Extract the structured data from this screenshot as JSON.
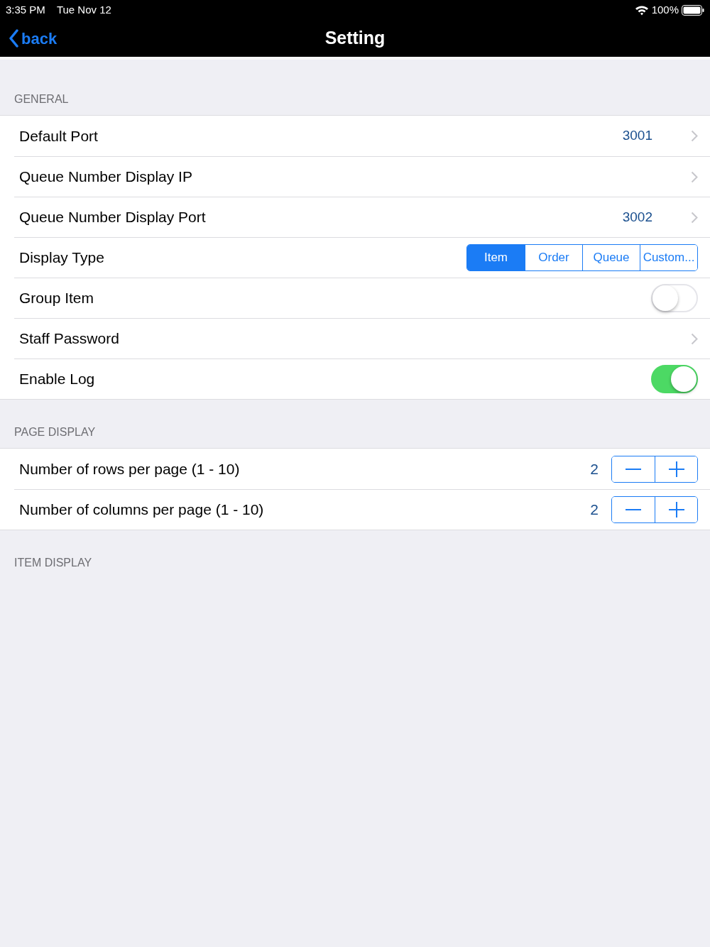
{
  "status_bar": {
    "time": "3:35 PM",
    "date": "Tue Nov 12",
    "battery": "100%"
  },
  "nav": {
    "back": "back",
    "title": "Setting"
  },
  "sections": [
    {
      "header": "GENERAL",
      "rows": [
        {
          "kind": "disclosure",
          "label": "Default Port",
          "value": "3001"
        },
        {
          "kind": "disclosure",
          "label": "Queue Number Display IP"
        },
        {
          "kind": "disclosure",
          "label": "Queue Number Display Port",
          "value": "3002"
        },
        {
          "kind": "segmented",
          "label": "Display Type",
          "segments": [
            {
              "label": "Item",
              "selected": true
            },
            {
              "label": "Order",
              "selected": false
            },
            {
              "label": "Queue",
              "selected": false
            },
            {
              "label": "Custom...",
              "selected": false
            }
          ]
        },
        {
          "kind": "switch",
          "label": "Group Item",
          "on": false
        },
        {
          "kind": "disclosure",
          "label": "Staff Password"
        },
        {
          "kind": "switch",
          "label": "Enable Log",
          "on": true
        }
      ]
    },
    {
      "header": "PAGE DISPLAY",
      "rows": [
        {
          "kind": "stepper",
          "label": "Number of rows per page (1 - 10)",
          "value": "2"
        },
        {
          "kind": "stepper",
          "label": "Number of columns per page (1 - 10)",
          "value": "2"
        }
      ]
    },
    {
      "header": "ITEM DISPLAY"
    }
  ]
}
